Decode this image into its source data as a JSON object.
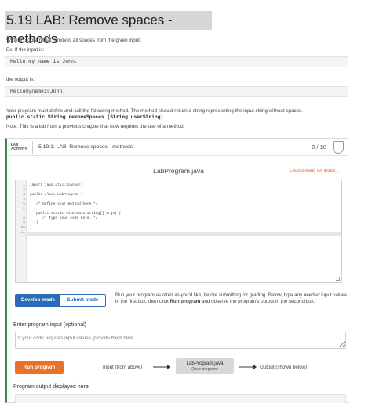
{
  "title": "5.19 LAB: Remove spaces - methods",
  "para1": "Write a program that removes all spaces from the given input.",
  "para2": "Ex: If the input is:",
  "example_input": "Hello my name is John.",
  "para3": "the output is:",
  "example_output": "HellomynameisJohn.",
  "para4": "Your program must define and call the following method. The method should return a string representing the input string without spaces.",
  "method_signature": "public static String removeSpaces (String userString)",
  "note": "Note: This is a lab from a previous chapter that now requires the use of a method.",
  "lab": {
    "tag_line1": "LAB",
    "tag_line2": "ACTIVITY",
    "name": "5.19.1: LAB: Remove spaces - methods",
    "score": "0 / 10"
  },
  "editor": {
    "file_name": "LabProgram.java",
    "load_template": "Load default template...",
    "line_numbers": [
      "1",
      "2",
      "3",
      "4",
      "5",
      "6",
      "7",
      "8",
      "9",
      "10",
      "11"
    ],
    "lines": [
      "import java.util.Scanner;",
      "",
      "public class LabProgram {",
      "",
      "   /* Define your method here */",
      "",
      "   public static void main(String[] args) {",
      "      /* Type your code here. */",
      "   }",
      "}",
      ""
    ]
  },
  "modes": {
    "develop": "Develop mode",
    "submit": "Submit mode"
  },
  "run_description": {
    "part1": "Run your program as often as you'd like, before submitting for grading. Below, type any needed input values in the first box, then click ",
    "bold1": "Run program",
    "part2": " and observe the program's output in the second box."
  },
  "input": {
    "label": "Enter program input (optional)",
    "placeholder": "If your code requires input values, provide them here."
  },
  "run_button": "Run program",
  "flow": {
    "input_from": "Input (from above)",
    "box_title": "LabProgram.java",
    "box_sub": "(Your program)",
    "output_to": "Output (shown below)"
  },
  "output_label": "Program output displayed here"
}
